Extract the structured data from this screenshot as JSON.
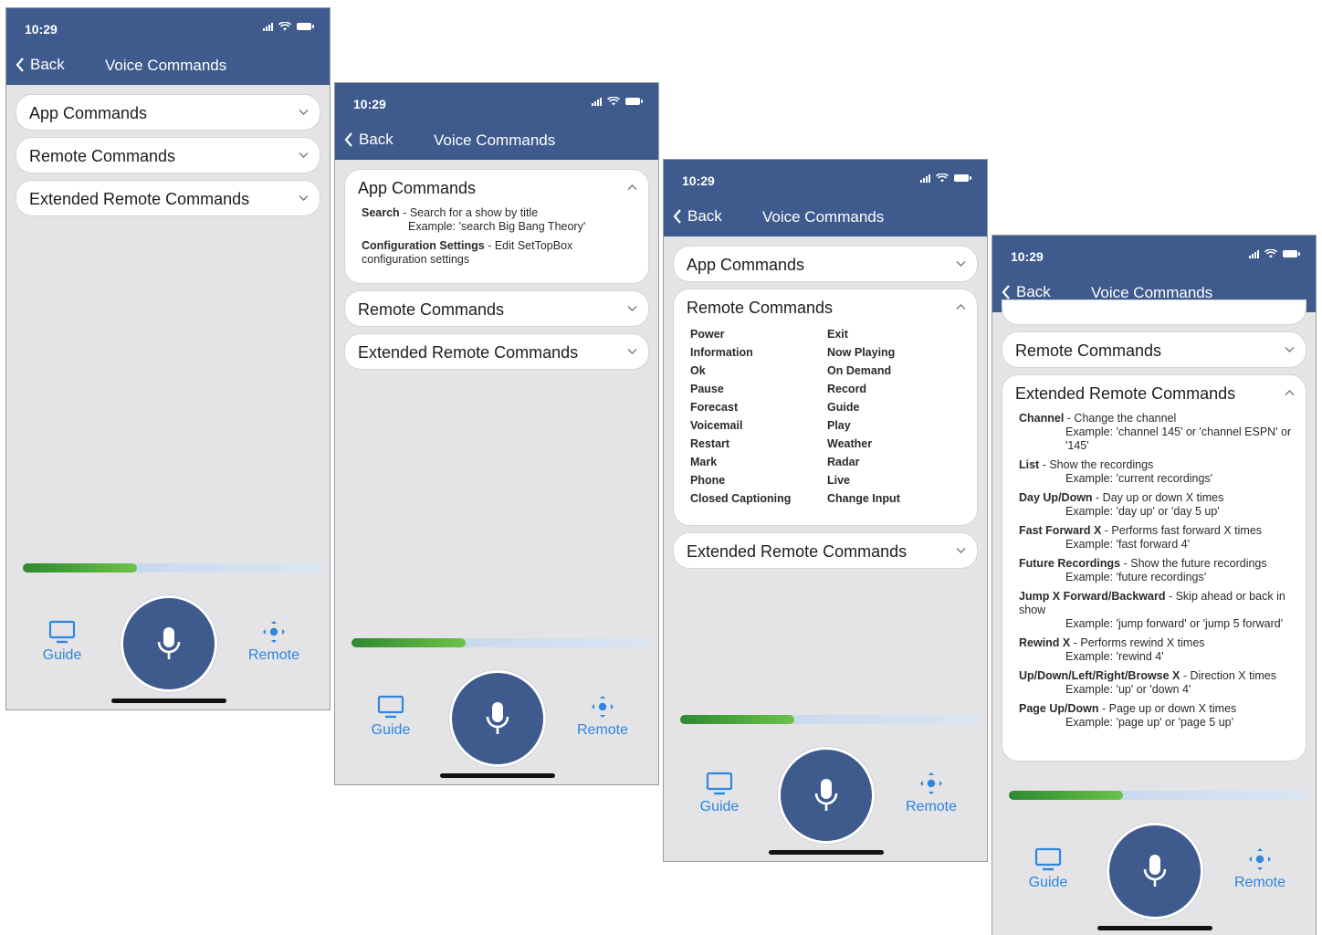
{
  "status": {
    "time": "10:29"
  },
  "nav": {
    "back": "Back",
    "title": "Voice Commands"
  },
  "sections": {
    "app": "App Commands",
    "remote": "Remote Commands",
    "extended": "Extended Remote Commands"
  },
  "app_commands": [
    {
      "name": "Search",
      "desc": "Search for a show by title",
      "example": "Example: 'search Big Bang Theory'"
    },
    {
      "name": "Configuration Settings",
      "desc": "Edit SetTopBox configuration settings"
    }
  ],
  "remote_commands": {
    "left": [
      "Power",
      "Information",
      "Ok",
      "Pause",
      "Forecast",
      "Voicemail",
      "Restart",
      "Mark",
      "Phone",
      "Closed Captioning"
    ],
    "right": [
      "Exit",
      "Now Playing",
      "On Demand",
      "Record",
      "Guide",
      "Play",
      "Weather",
      "Radar",
      "Live",
      "Change Input"
    ]
  },
  "extended_commands": [
    {
      "name": "Channel",
      "desc": "Change the channel",
      "example": "Example: 'channel 145' or 'channel ESPN' or '145'"
    },
    {
      "name": "List",
      "desc": "Show the recordings",
      "example": "Example: 'current recordings'"
    },
    {
      "name": "Day Up/Down",
      "desc": "Day up or down X times",
      "example": "Example: 'day up' or 'day 5 up'"
    },
    {
      "name": "Fast Forward X",
      "desc": "Performs fast forward X times",
      "example": "Example: 'fast forward 4'"
    },
    {
      "name": "Future Recordings",
      "desc": "Show the future recordings",
      "example": "Example: 'future recordings'"
    },
    {
      "name": "Jump X Forward/Backward",
      "desc": "Skip ahead or back in show",
      "example": "Example: 'jump forward' or 'jump 5 forward'"
    },
    {
      "name": "Rewind X",
      "desc": "Performs rewind X times",
      "example": "Example: 'rewind 4'"
    },
    {
      "name": "Up/Down/Left/Right/Browse X",
      "desc": "Direction X times",
      "example": "Example: 'up' or 'down 4'"
    },
    {
      "name": "Page Up/Down",
      "desc": "Page up or down X times",
      "example": "Example: 'page up' or 'page 5 up'"
    }
  ],
  "bottom": {
    "guide": "Guide",
    "remote": "Remote"
  },
  "progress_fraction": 0.38,
  "colors": {
    "header": "#3f5b8e",
    "accent": "#2f86df",
    "progress": "#3fa535"
  }
}
